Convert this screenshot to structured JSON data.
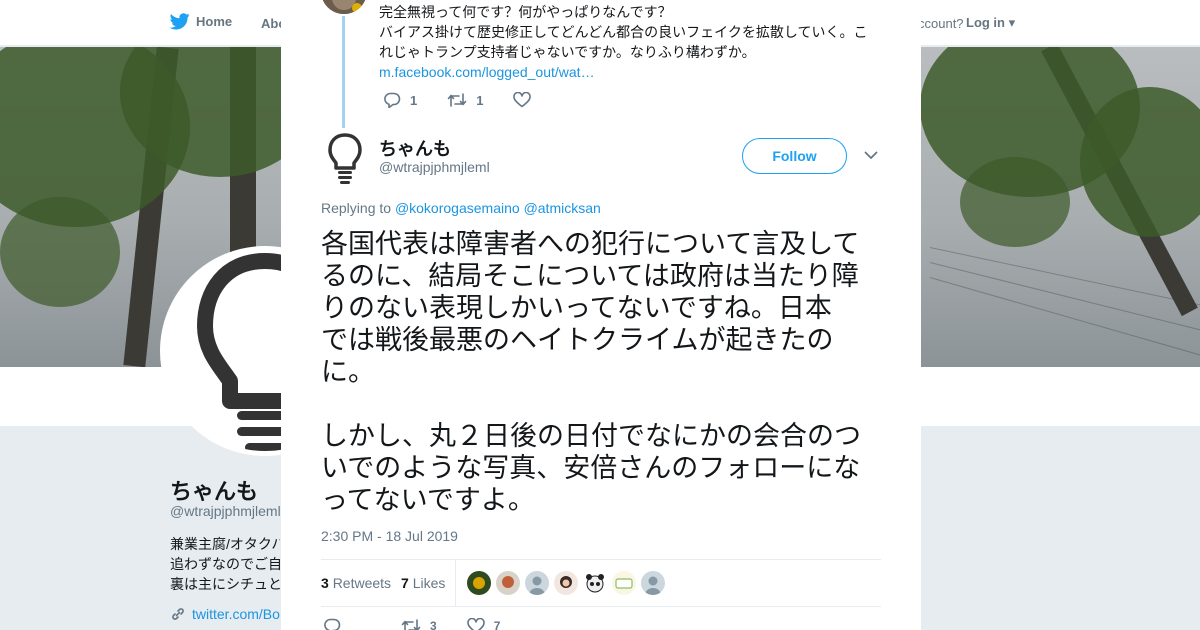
{
  "topbar": {
    "home_label": "Home",
    "about_label": "Abo",
    "account_label": "ccount?",
    "login_label": "Log in"
  },
  "profile_bg": {
    "name": "ちゃんも",
    "handle": "@wtrajpjphmjleml",
    "bio_lines": [
      "兼業主腐/オタクハ",
      "追わずなのでご自",
      "裏は主にシチュと"
    ],
    "link": "twitter.com/Bo"
  },
  "parent_tweet": {
    "lines": [
      "完全無視って何です？何がやっぱりなんです？",
      "バイアス掛けて歴史修正してどんどん都合の良いフェイクを拡散していく。こ",
      "れじゃトランプ支持者じゃないですか。なりふり構わずか。"
    ],
    "link": "m.facebook.com/logged_out/wat…",
    "reply_count": "1",
    "retweet_count": "1"
  },
  "tweet": {
    "author_name": "ちゃんも",
    "author_handle": "@wtrajpjphmjleml",
    "follow_label": "Follow",
    "replying_prefix": "Replying to",
    "replying_to_1": "@kokorogasemaino",
    "replying_to_2": "@atmicksan",
    "body_lines_1": [
      "各国代表は障害者への犯行について言及して",
      "るのに、結局そこについては政府は当たり障",
      "りのない表現しかいってないですね。日本",
      "では戦後最悪のヘイトクライムが起きたの",
      "に。"
    ],
    "body_lines_2": [
      "しかし、丸２日後の日付でなにかの会合のつ",
      "いでのような写真、安倍さんのフォローにな",
      "ってないですよ。"
    ],
    "timestamp": "2:30 PM - 18 Jul 2019",
    "retweets_count": "3",
    "retweets_label": "Retweets",
    "likes_count": "7",
    "likes_label": "Likes",
    "bottom_retweet_count": "3",
    "bottom_like_count": "7"
  },
  "colors": {
    "accent": "#1da1f2",
    "link": "#1b95e0",
    "muted": "#657786",
    "thread_line": "#a3d1ef"
  }
}
